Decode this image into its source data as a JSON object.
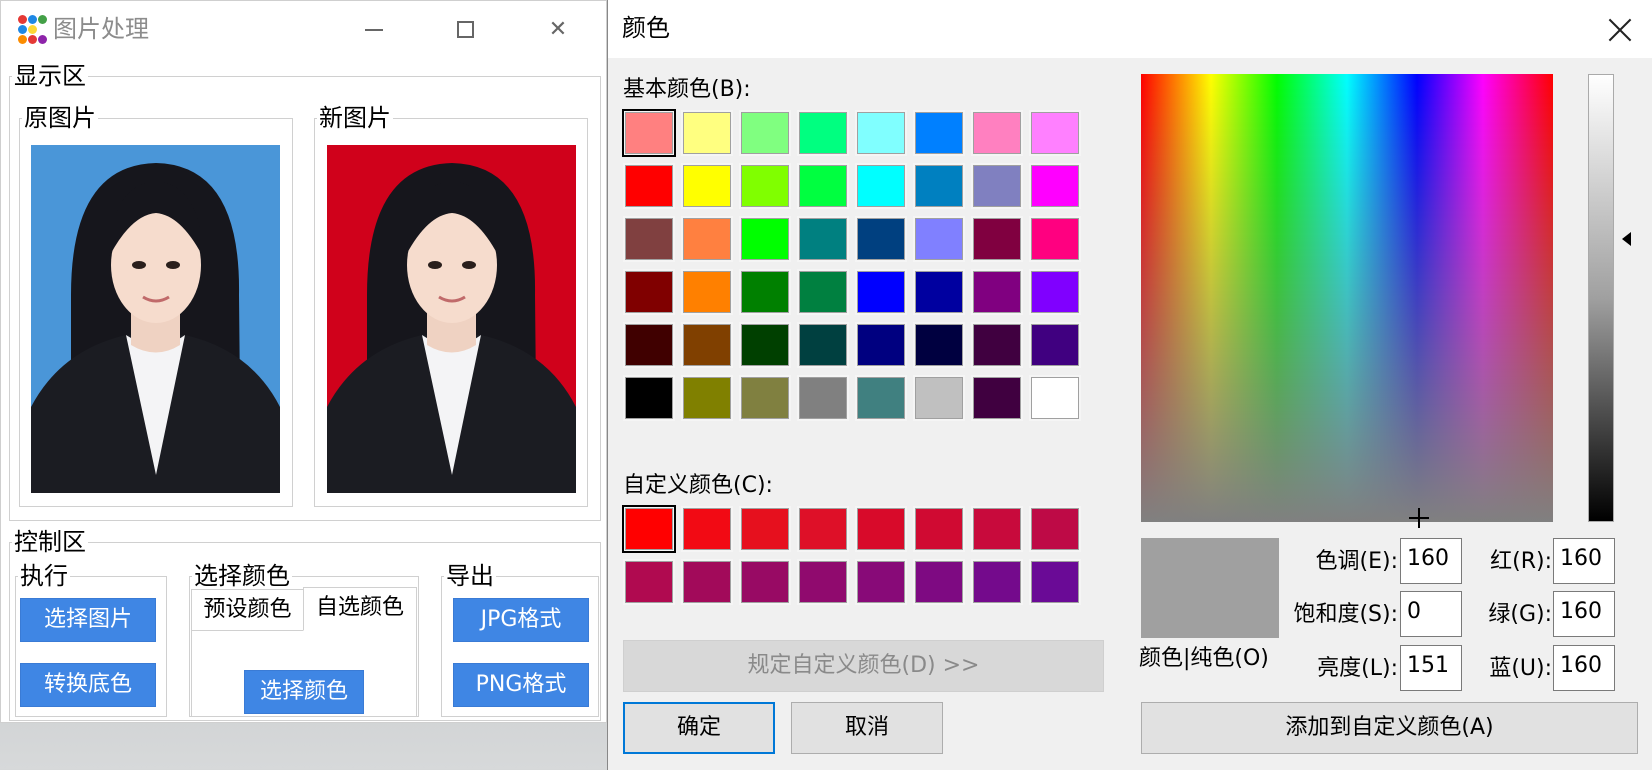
{
  "app": {
    "title": "图片处理",
    "display_group": "显示区",
    "original_group": "原图片",
    "new_group": "新图片",
    "control_group": "控制区",
    "exec_group": "执行",
    "color_group": "选择颜色",
    "export_group": "导出",
    "buttons": {
      "select_image": "选择图片",
      "convert_background": "转换底色",
      "choose_color": "选择颜色",
      "jpg": "JPG格式",
      "png": "PNG格式"
    },
    "tabs": [
      "预设颜色",
      "自选颜色"
    ],
    "active_tab": "自选颜色",
    "original_bg_color": "#4a96d8",
    "new_bg_color": "#d0011b"
  },
  "dialog": {
    "title": "颜色",
    "basic_colors_label": "基本颜色(B):",
    "custom_colors_label": "自定义颜色(C):",
    "basic_colors": [
      "#ff8080",
      "#ffff80",
      "#80ff80",
      "#00ff80",
      "#80ffff",
      "#0080ff",
      "#ff80c0",
      "#ff80ff",
      "#ff0000",
      "#ffff00",
      "#80ff00",
      "#00ff40",
      "#00ffff",
      "#0080c0",
      "#8080c0",
      "#ff00ff",
      "#804040",
      "#ff8040",
      "#00ff00",
      "#008080",
      "#004080",
      "#8080ff",
      "#800040",
      "#ff0080",
      "#800000",
      "#ff8000",
      "#008000",
      "#008040",
      "#0000ff",
      "#0000a0",
      "#800080",
      "#8000ff",
      "#400000",
      "#804000",
      "#004000",
      "#004040",
      "#000080",
      "#000040",
      "#400040",
      "#400080",
      "#000000",
      "#808000",
      "#808040",
      "#808080",
      "#408080",
      "#c0c0c0",
      "#400040",
      "#ffffff"
    ],
    "custom_colors": [
      "#ff0000",
      "#f20a14",
      "#e6101e",
      "#de1028",
      "#d80a2a",
      "#d00a32",
      "#c80a3c",
      "#be0a46",
      "#b00a50",
      "#a20a5a",
      "#980a64",
      "#900a6e",
      "#880a78",
      "#7e0a82",
      "#740a8c",
      "#6a0a96"
    ],
    "selected_basic_index": 0,
    "selected_custom_index": 0,
    "preview_color": "#a0a0a0",
    "preview_label": "颜色|纯色(O)",
    "fields": {
      "hue_label": "色调(E):",
      "hue": "160",
      "sat_label": "饱和度(S):",
      "sat": "0",
      "lum_label": "亮度(L):",
      "lum": "151",
      "red_label": "红(R):",
      "red": "160",
      "green_label": "绿(G):",
      "green": "160",
      "blue_label": "蓝(U):",
      "blue": "160"
    },
    "buttons": {
      "define_custom": "规定自定义颜色(D) >>",
      "ok": "确定",
      "cancel": "取消",
      "add_custom": "添加到自定义颜色(A)"
    }
  }
}
